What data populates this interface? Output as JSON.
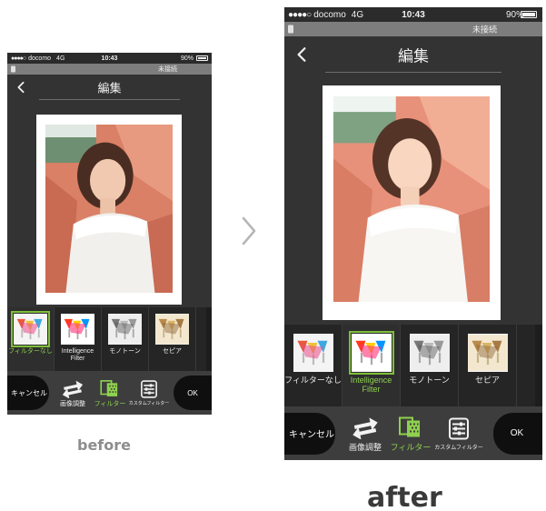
{
  "status_bar": {
    "signal_dots": "●●●●○",
    "carrier": "docomo",
    "network": "4G",
    "time": "10:43",
    "battery": "90%"
  },
  "connection_bar": {
    "text": "未接続"
  },
  "header": {
    "title": "編集"
  },
  "filters": [
    {
      "label": "フィルターなし",
      "style": "original",
      "active": true
    },
    {
      "label": "Intelligence Filter",
      "style": "vivid",
      "active": false
    },
    {
      "label": "モノトーン",
      "style": "mono",
      "active": false
    },
    {
      "label": "セピア",
      "style": "sepia",
      "active": false
    }
  ],
  "toolbar": {
    "cancel_label": "キャンセル",
    "adjust_label": "画像調整",
    "filter_label": "フィルター",
    "custom_filter_label": "カスタムフィルター",
    "ok_label": "OK"
  },
  "captions": {
    "before": "before",
    "after": "after"
  },
  "colors": {
    "accent": "#8fd14f",
    "app_background": "#333333",
    "status_bar": "#2b2b2b",
    "connection_bar": "#7d7d7d",
    "filter_strip": "#252525",
    "toolbar": "#3d3d3d",
    "pill": "#0f0f0f"
  },
  "icons": {
    "back": "chevron-left-icon",
    "adjust": "swap-arrows-icon",
    "filter": "filter-layers-icon",
    "custom_filter": "sliders-icon",
    "next": "chevron-right-icon"
  }
}
